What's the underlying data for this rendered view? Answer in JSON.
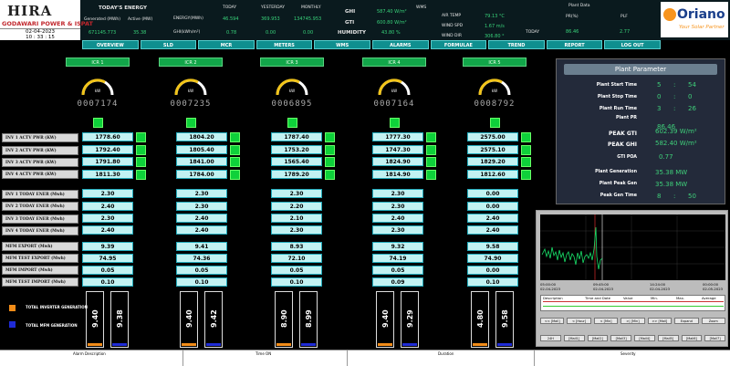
{
  "header": {
    "logo_left": {
      "name": "HIRA",
      "subtitle": "GODAWARI POWER & ISPAT",
      "date": "02-04-2023",
      "time": "10 : 33 : 15"
    },
    "today_energy_label": "TODAY'S ENERGY",
    "generated_label": "Generated (MWh)",
    "active_mw_label": "Active (MW)",
    "generated_value": "671145.773",
    "active_value": "35.38",
    "energy_label": "ENERGY(MWh)",
    "today_label": "TODAY",
    "yesterday_label": "YESTERDAY",
    "monthly_label": "MONTHLY",
    "energy_today": "46.594",
    "energy_yesterday": "369.953",
    "energy_monthly": "134745.953",
    "ghi_kwh_label": "GHI(kWh/m²)",
    "ghi_today": "0.78",
    "ghi_yesterday": "0.00",
    "ghi_monthly": "0.00",
    "ghi_label": "GHI",
    "ghi_value": "587.40 W/m²",
    "gti_label": "GTI",
    "gti_value": "600.80 W/m²",
    "humidity_label": "HUMIDITY",
    "humidity_value": "43.80 %",
    "wms_label": "WMS",
    "air_temp_label": "AIR TEMP",
    "air_temp_value": "79.13 °C",
    "wind_spd_label": "WIND SPD",
    "wind_spd_value": "1.67 m/s",
    "wind_dir_label": "WIND DIR",
    "wind_dir_value": "306.80 °",
    "plant_data_label": "Plant Data",
    "pr_label": "PR(%)",
    "plf_label": "PLF",
    "plant_today_label": "TODAY",
    "pr_value": "86.46",
    "plf_value": "2.77",
    "logo_right": {
      "name": "Oriano",
      "tagline": "Your Solar Partner"
    }
  },
  "nav": [
    "OVERVIEW",
    "SLD",
    "MCR",
    "METERS",
    "WMS",
    "ALARMS",
    "FORMULAE",
    "TREND",
    "REPORT",
    "LOG OUT"
  ],
  "inverters": [
    {
      "title": "ICR 1",
      "unit": "kW",
      "counter": "0007174",
      "pwr": [
        "1778.60",
        "1792.40",
        "1791.80",
        "1811.30"
      ],
      "energy": [
        "2.30",
        "2.40",
        "2.30",
        "2.40"
      ],
      "export": "9.39",
      "test_export": "74.95",
      "import": "0.05",
      "test_import": "0.10",
      "bar1": "9.40",
      "bar2": "9.38"
    },
    {
      "title": "ICR 2",
      "unit": "kW",
      "counter": "0007235",
      "pwr": [
        "1804.20",
        "1805.40",
        "1841.00",
        "1784.00"
      ],
      "energy": [
        "2.30",
        "2.30",
        "2.40",
        "2.40"
      ],
      "export": "9.41",
      "test_export": "74.36",
      "import": "0.05",
      "test_import": "0.10",
      "bar1": "9.40",
      "bar2": "9.42"
    },
    {
      "title": "ICR 3",
      "unit": "kW",
      "counter": "0006895",
      "pwr": [
        "1787.40",
        "1753.20",
        "1565.40",
        "1789.20"
      ],
      "energy": [
        "2.30",
        "2.20",
        "2.10",
        "2.30"
      ],
      "export": "8.93",
      "test_export": "72.10",
      "import": "0.05",
      "test_import": "0.10",
      "bar1": "8.90",
      "bar2": "8.99"
    },
    {
      "title": "ICR 4",
      "unit": "kW",
      "counter": "0007164",
      "pwr": [
        "1777.30",
        "1747.30",
        "1824.90",
        "1814.90"
      ],
      "energy": [
        "2.30",
        "2.30",
        "2.40",
        "2.30"
      ],
      "export": "9.32",
      "test_export": "74.19",
      "import": "0.05",
      "test_import": "0.09",
      "bar1": "9.40",
      "bar2": "9.29"
    },
    {
      "title": "ICR 5",
      "unit": "kW",
      "counter": "0008792",
      "pwr": [
        "2575.00",
        "2575.10",
        "1829.20",
        "1812.60"
      ],
      "energy": [
        "0.00",
        "0.00",
        "2.40",
        "2.40"
      ],
      "export": "9.58",
      "test_export": "74.90",
      "import": "0.00",
      "test_import": "0.10",
      "bar1": "4.80",
      "bar2": "9.58"
    }
  ],
  "row_labels": {
    "pwr": [
      "INV 1 ACTV PWR (KW)",
      "INV 2 ACTV PWR (KW)",
      "INV 3 ACTV PWR (KW)",
      "INV 4 ACTV PWR (KW)"
    ],
    "energy": [
      "INV 1 TODAY ENER (Mwh)",
      "INV 2 TODAY ENER (Mwh)",
      "INV 3 TODAY ENER (Mwh)",
      "INV 4 TODAY ENER (Mwh)"
    ],
    "export": "MFM EXPORT (Mwh)",
    "test_export": "MFM TEST EXPORT (Mwh)",
    "import": "MFM IMPORT (Mwh)",
    "test_import": "MFM TEST IMPORT (Mwh)"
  },
  "legend": {
    "inverter": "TOTAL INVERTER GENERATION",
    "mfm": "TOTAL MFM GENERATION",
    "inverter_color": "#f28c18",
    "mfm_color": "#1f2bd6"
  },
  "plant": {
    "title": "Plant Parameter",
    "start_label": "Plant Start Time",
    "start_h": "5",
    "start_m": "54",
    "stop_label": "Plant Stop Time",
    "stop_h": "0",
    "stop_m": "0",
    "run_label": "Plant Run Time",
    "run_h": "3",
    "run_m": "26",
    "pr_label": "Plant PR",
    "pr_value": "86.46",
    "gti_label": "PEAK GTI",
    "gti_value": "602.39 W/m²",
    "ghi_label": "PEAK GHI",
    "ghi_value": "582.40 W/m²",
    "poa_label": "GTI POA",
    "poa_value": "0.77",
    "gen_label": "Plant Generation",
    "gen_value": "35.38 MW",
    "peak_gen_label": "Plant Peak Gen",
    "peak_gen_value": "35.38 MW",
    "peak_time_label": "Peak Gen Time",
    "peak_time_h": "8",
    "peak_time_m": "50"
  },
  "trend": {
    "t1": "05:00:00",
    "d1": "02-04-2023",
    "t2": "09:45:00",
    "d2": "02-04-2023",
    "t3": "14:24:00",
    "d3": "02-04-2023",
    "t4": "00:00:00",
    "d4": "02-05-2023",
    "col_desc": "Description",
    "col_time": "Time and Date",
    "col_value": "Value",
    "col_min": "Min.",
    "col_max": "Max.",
    "col_avg": "Average",
    "btn_row1": [
      "<< [Mail]",
      "< [Hour]",
      "< [Min]",
      ">| [Min]",
      ">> [Mail]",
      "Expand",
      "Zoom"
    ],
    "btn_row2": [
      "24H",
      "[Mail1]",
      "[Mail2]",
      "[Mail3]",
      "[Mail4]",
      "[Mail5]",
      "[Mail6]",
      "[Mail7]"
    ]
  },
  "alarms": {
    "desc": "Alarm Description",
    "time_on": "Time ON",
    "duration": "Duration",
    "severity": "Severity"
  }
}
